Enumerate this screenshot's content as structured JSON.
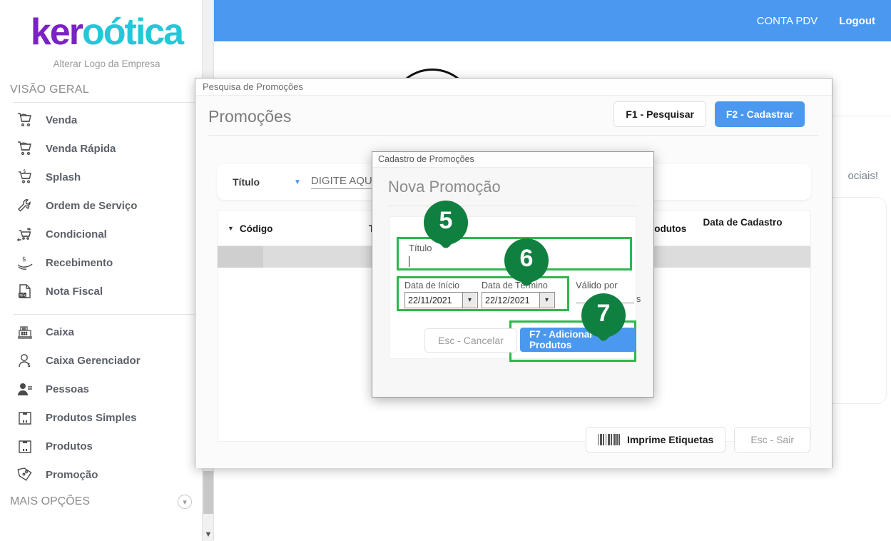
{
  "brand": {
    "logo_part1": "ker",
    "logo_part2": "o",
    "logo_part3": "ótica",
    "change_logo_label": "Alterar Logo da Empresa",
    "accent_purple": "#7b22c4",
    "accent_cyan": "#22c8d8",
    "accent_blue": "#4a98f0",
    "marker_green": "#108040",
    "highlight_green": "#2db84d"
  },
  "topbar": {
    "account_label": "CONTA PDV",
    "logout_label": "Logout"
  },
  "sidebar": {
    "section_title": "VISÃO GERAL",
    "more_options_label": "MAIS OPÇÕES",
    "group1": [
      {
        "label": "Venda",
        "icon": "shopping-cart-icon"
      },
      {
        "label": "Venda Rápida",
        "icon": "shopping-cart-fast-icon"
      },
      {
        "label": "Splash",
        "icon": "cart-dollar-icon"
      },
      {
        "label": "Ordem de Serviço",
        "icon": "wrench-icon"
      },
      {
        "label": "Condicional",
        "icon": "cart-arrows-icon"
      },
      {
        "label": "Recebimento",
        "icon": "hand-money-icon"
      },
      {
        "label": "Nota Fiscal",
        "icon": "nfe-document-icon"
      }
    ],
    "group2": [
      {
        "label": "Caixa",
        "icon": "cash-register-icon"
      },
      {
        "label": "Caixa Gerenciador",
        "icon": "user-money-icon"
      },
      {
        "label": "Pessoas",
        "icon": "user-list-icon"
      },
      {
        "label": "Produtos Simples",
        "icon": "box-icon"
      },
      {
        "label": "Produtos",
        "icon": "box-icon"
      },
      {
        "label": "Promoção",
        "icon": "price-tags-icon"
      }
    ]
  },
  "background_page": {
    "social_text": "ociais!"
  },
  "outer_dialog": {
    "window_title": "Pesquisa de Promoções",
    "heading": "Promoções",
    "search": {
      "field_label": "Título",
      "dropdown_icon": "chevron-down-icon",
      "input_value": "DIGITE AQUI SUA",
      "placeholder": "DIGITE AQUI SUA PESQUISA"
    },
    "buttons": {
      "search": "F1 - Pesquisar",
      "register": "F2 - Cadastrar"
    },
    "grid": {
      "columns": [
        {
          "label": "Código",
          "sorted": true
        },
        {
          "label": "Tít",
          "sorted": false
        },
        {
          "label": "Produtos",
          "sorted": false
        },
        {
          "label": "Data de Cadastro",
          "sorted": false
        }
      ],
      "rows": [
        {
          "codigo": "",
          "titulo": "",
          "produtos": "",
          "data": ""
        }
      ]
    },
    "footer": {
      "print_labels": "Imprime Etiquetas",
      "print_icon": "barcode-icon",
      "exit": "Esc - Sair"
    }
  },
  "inner_dialog": {
    "window_title": "Cadastro de Promoções",
    "heading": "Nova Promoção",
    "fields": {
      "titulo_label": "Título",
      "titulo_value": "",
      "data_inicio_label": "Data de Início",
      "data_inicio_value": "22/11/2021",
      "data_termino_label": "Data de Término",
      "data_termino_value": "22/12/2021",
      "valido_por_label": "Válido por",
      "valido_por_value": "",
      "valido_por_suffix": "s"
    },
    "buttons": {
      "cancel": "Esc - Cancelar",
      "add_products": "F7 - Adicionar Produtos"
    }
  },
  "markers": [
    {
      "number": "5",
      "target": "titulo-field"
    },
    {
      "number": "6",
      "target": "date-fields"
    },
    {
      "number": "7",
      "target": "add-products-button"
    }
  ]
}
